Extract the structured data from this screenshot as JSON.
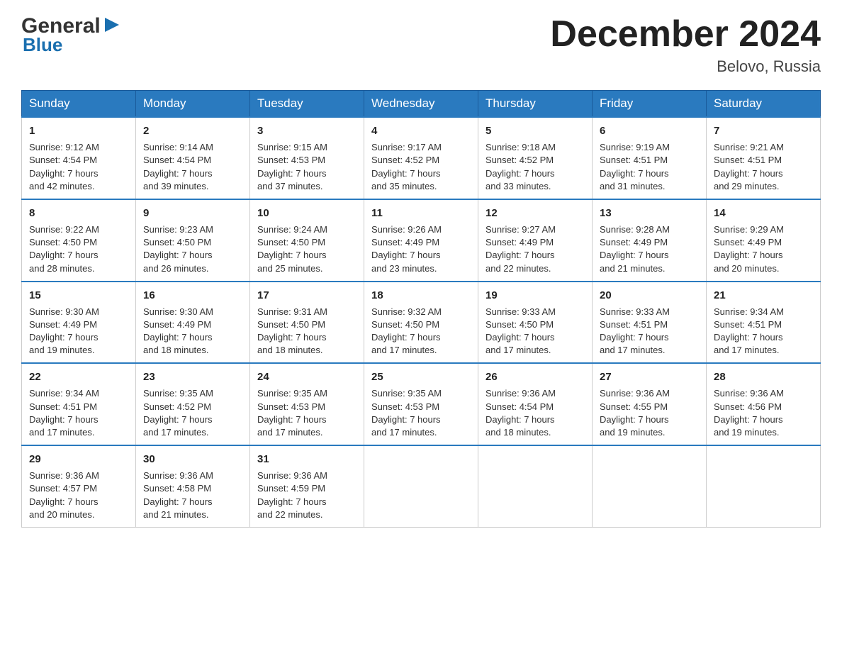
{
  "logo": {
    "general": "General",
    "blue": "Blue",
    "arrow": "▶"
  },
  "title": "December 2024",
  "location": "Belovo, Russia",
  "days_of_week": [
    "Sunday",
    "Monday",
    "Tuesday",
    "Wednesday",
    "Thursday",
    "Friday",
    "Saturday"
  ],
  "weeks": [
    [
      {
        "day": "1",
        "sunrise": "Sunrise: 9:12 AM",
        "sunset": "Sunset: 4:54 PM",
        "daylight": "Daylight: 7 hours",
        "daylight2": "and 42 minutes."
      },
      {
        "day": "2",
        "sunrise": "Sunrise: 9:14 AM",
        "sunset": "Sunset: 4:54 PM",
        "daylight": "Daylight: 7 hours",
        "daylight2": "and 39 minutes."
      },
      {
        "day": "3",
        "sunrise": "Sunrise: 9:15 AM",
        "sunset": "Sunset: 4:53 PM",
        "daylight": "Daylight: 7 hours",
        "daylight2": "and 37 minutes."
      },
      {
        "day": "4",
        "sunrise": "Sunrise: 9:17 AM",
        "sunset": "Sunset: 4:52 PM",
        "daylight": "Daylight: 7 hours",
        "daylight2": "and 35 minutes."
      },
      {
        "day": "5",
        "sunrise": "Sunrise: 9:18 AM",
        "sunset": "Sunset: 4:52 PM",
        "daylight": "Daylight: 7 hours",
        "daylight2": "and 33 minutes."
      },
      {
        "day": "6",
        "sunrise": "Sunrise: 9:19 AM",
        "sunset": "Sunset: 4:51 PM",
        "daylight": "Daylight: 7 hours",
        "daylight2": "and 31 minutes."
      },
      {
        "day": "7",
        "sunrise": "Sunrise: 9:21 AM",
        "sunset": "Sunset: 4:51 PM",
        "daylight": "Daylight: 7 hours",
        "daylight2": "and 29 minutes."
      }
    ],
    [
      {
        "day": "8",
        "sunrise": "Sunrise: 9:22 AM",
        "sunset": "Sunset: 4:50 PM",
        "daylight": "Daylight: 7 hours",
        "daylight2": "and 28 minutes."
      },
      {
        "day": "9",
        "sunrise": "Sunrise: 9:23 AM",
        "sunset": "Sunset: 4:50 PM",
        "daylight": "Daylight: 7 hours",
        "daylight2": "and 26 minutes."
      },
      {
        "day": "10",
        "sunrise": "Sunrise: 9:24 AM",
        "sunset": "Sunset: 4:50 PM",
        "daylight": "Daylight: 7 hours",
        "daylight2": "and 25 minutes."
      },
      {
        "day": "11",
        "sunrise": "Sunrise: 9:26 AM",
        "sunset": "Sunset: 4:49 PM",
        "daylight": "Daylight: 7 hours",
        "daylight2": "and 23 minutes."
      },
      {
        "day": "12",
        "sunrise": "Sunrise: 9:27 AM",
        "sunset": "Sunset: 4:49 PM",
        "daylight": "Daylight: 7 hours",
        "daylight2": "and 22 minutes."
      },
      {
        "day": "13",
        "sunrise": "Sunrise: 9:28 AM",
        "sunset": "Sunset: 4:49 PM",
        "daylight": "Daylight: 7 hours",
        "daylight2": "and 21 minutes."
      },
      {
        "day": "14",
        "sunrise": "Sunrise: 9:29 AM",
        "sunset": "Sunset: 4:49 PM",
        "daylight": "Daylight: 7 hours",
        "daylight2": "and 20 minutes."
      }
    ],
    [
      {
        "day": "15",
        "sunrise": "Sunrise: 9:30 AM",
        "sunset": "Sunset: 4:49 PM",
        "daylight": "Daylight: 7 hours",
        "daylight2": "and 19 minutes."
      },
      {
        "day": "16",
        "sunrise": "Sunrise: 9:30 AM",
        "sunset": "Sunset: 4:49 PM",
        "daylight": "Daylight: 7 hours",
        "daylight2": "and 18 minutes."
      },
      {
        "day": "17",
        "sunrise": "Sunrise: 9:31 AM",
        "sunset": "Sunset: 4:50 PM",
        "daylight": "Daylight: 7 hours",
        "daylight2": "and 18 minutes."
      },
      {
        "day": "18",
        "sunrise": "Sunrise: 9:32 AM",
        "sunset": "Sunset: 4:50 PM",
        "daylight": "Daylight: 7 hours",
        "daylight2": "and 17 minutes."
      },
      {
        "day": "19",
        "sunrise": "Sunrise: 9:33 AM",
        "sunset": "Sunset: 4:50 PM",
        "daylight": "Daylight: 7 hours",
        "daylight2": "and 17 minutes."
      },
      {
        "day": "20",
        "sunrise": "Sunrise: 9:33 AM",
        "sunset": "Sunset: 4:51 PM",
        "daylight": "Daylight: 7 hours",
        "daylight2": "and 17 minutes."
      },
      {
        "day": "21",
        "sunrise": "Sunrise: 9:34 AM",
        "sunset": "Sunset: 4:51 PM",
        "daylight": "Daylight: 7 hours",
        "daylight2": "and 17 minutes."
      }
    ],
    [
      {
        "day": "22",
        "sunrise": "Sunrise: 9:34 AM",
        "sunset": "Sunset: 4:51 PM",
        "daylight": "Daylight: 7 hours",
        "daylight2": "and 17 minutes."
      },
      {
        "day": "23",
        "sunrise": "Sunrise: 9:35 AM",
        "sunset": "Sunset: 4:52 PM",
        "daylight": "Daylight: 7 hours",
        "daylight2": "and 17 minutes."
      },
      {
        "day": "24",
        "sunrise": "Sunrise: 9:35 AM",
        "sunset": "Sunset: 4:53 PM",
        "daylight": "Daylight: 7 hours",
        "daylight2": "and 17 minutes."
      },
      {
        "day": "25",
        "sunrise": "Sunrise: 9:35 AM",
        "sunset": "Sunset: 4:53 PM",
        "daylight": "Daylight: 7 hours",
        "daylight2": "and 17 minutes."
      },
      {
        "day": "26",
        "sunrise": "Sunrise: 9:36 AM",
        "sunset": "Sunset: 4:54 PM",
        "daylight": "Daylight: 7 hours",
        "daylight2": "and 18 minutes."
      },
      {
        "day": "27",
        "sunrise": "Sunrise: 9:36 AM",
        "sunset": "Sunset: 4:55 PM",
        "daylight": "Daylight: 7 hours",
        "daylight2": "and 19 minutes."
      },
      {
        "day": "28",
        "sunrise": "Sunrise: 9:36 AM",
        "sunset": "Sunset: 4:56 PM",
        "daylight": "Daylight: 7 hours",
        "daylight2": "and 19 minutes."
      }
    ],
    [
      {
        "day": "29",
        "sunrise": "Sunrise: 9:36 AM",
        "sunset": "Sunset: 4:57 PM",
        "daylight": "Daylight: 7 hours",
        "daylight2": "and 20 minutes."
      },
      {
        "day": "30",
        "sunrise": "Sunrise: 9:36 AM",
        "sunset": "Sunset: 4:58 PM",
        "daylight": "Daylight: 7 hours",
        "daylight2": "and 21 minutes."
      },
      {
        "day": "31",
        "sunrise": "Sunrise: 9:36 AM",
        "sunset": "Sunset: 4:59 PM",
        "daylight": "Daylight: 7 hours",
        "daylight2": "and 22 minutes."
      },
      null,
      null,
      null,
      null
    ]
  ]
}
